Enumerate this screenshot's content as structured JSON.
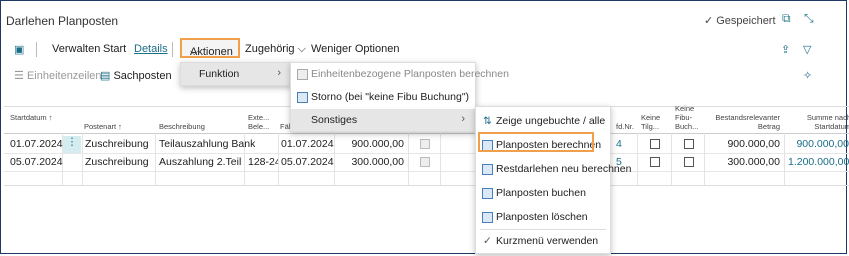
{
  "header": {
    "title": "Darlehen Planposten",
    "saved": "Gespeichert"
  },
  "actionbar": {
    "verwalten": "Verwalten",
    "start": "Start",
    "details": "Details",
    "aktionen": "Aktionen",
    "zugehoerig": "Zugehörig",
    "weniger": "Weniger Optionen"
  },
  "subbar": {
    "einheitenzeilen": "Einheitenzeilen",
    "sachposten": "Sachposten"
  },
  "columns": {
    "startdatum": "Startdatum ↑",
    "postenart": "Postenart ↑",
    "beschreibung": "Beschreibung",
    "exte1": "Exte...",
    "exte2": "Bele...",
    "faell": "Fäll",
    "lfdnr": "fd.Nr.",
    "keine_tilg1": "Keine",
    "keine_tilg2": "Tilg...",
    "keine_fibu1": "Keine",
    "keine_fibu2": "Fibu-",
    "keine_fibu3": "Buch...",
    "bestand1": "Bestandsrelevanter",
    "bestand2": "Betrag",
    "summe1": "Summe nach",
    "summe2": "Startdatum"
  },
  "rows": [
    {
      "startdatum": "01.07.2024",
      "postenart": "Zuschreibung",
      "beschreibung": "Teilauszahlung Bank",
      "beleg": "",
      "faellig": "01.07.2024",
      "betrag": "900.000,00",
      "lfdnr": "4",
      "bestand": "900.000,00",
      "summe": "900.000,00"
    },
    {
      "startdatum": "05.07.2024",
      "postenart": "Zuschreibung",
      "beschreibung": "Auszahlung 2.Teilbe...",
      "beleg": "128-24",
      "faellig": "05.07.2024",
      "betrag": "300.000,00",
      "lfdnr": "5",
      "bestand": "300.000,00",
      "summe": "1.200.000,00"
    }
  ],
  "menu1": {
    "funktion": "Funktion"
  },
  "menu2": {
    "items": [
      "Einheitenbezogene Planposten berechnen",
      "Storno (bei \"keine Fibu Buchung\")",
      "Sonstiges"
    ]
  },
  "menu3": {
    "items": [
      "Zeige ungebuchte / alle",
      "Planposten berechnen",
      "Restdarlehen neu berechnen",
      "Planposten buchen",
      "Planposten löschen",
      "Kurzmenü verwenden"
    ]
  }
}
